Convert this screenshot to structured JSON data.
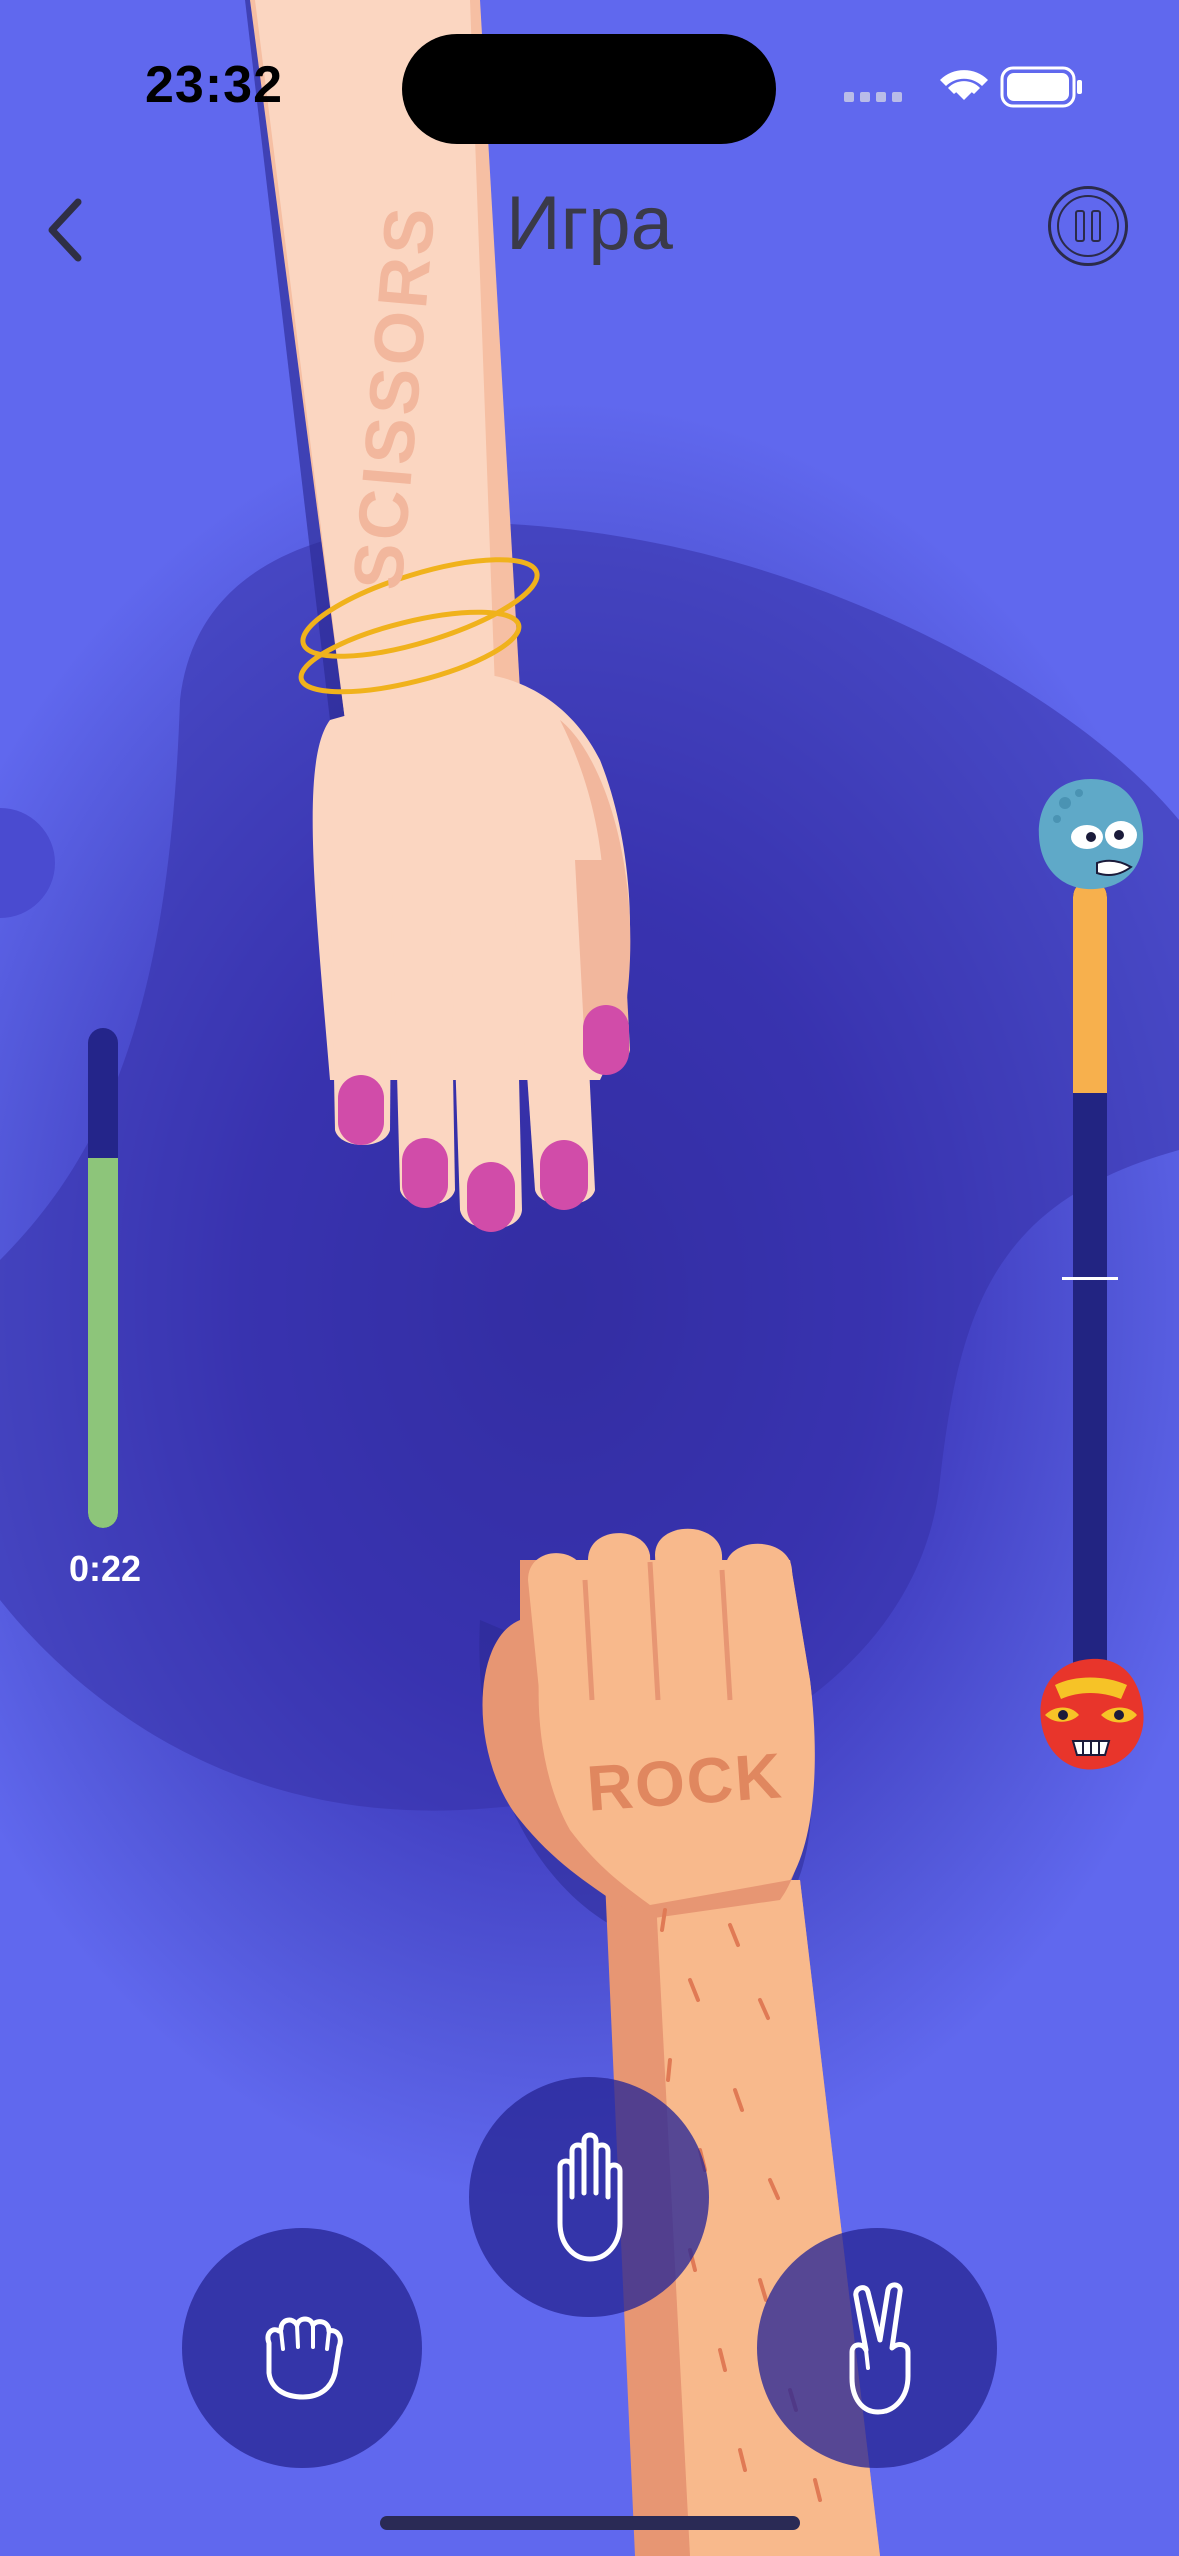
{
  "status_bar": {
    "time": "23:32"
  },
  "nav": {
    "title": "Игра"
  },
  "opponent_hand": {
    "label": "SCISSORS"
  },
  "player_hand": {
    "label": "ROCK"
  },
  "timer": {
    "text": "0:22",
    "fraction_remaining": 0.74
  },
  "score_bar": {
    "opponent_fraction": 0.26
  },
  "choices": [
    {
      "name": "rock",
      "icon": "fist-icon"
    },
    {
      "name": "paper",
      "icon": "open-hand-icon"
    },
    {
      "name": "scissors",
      "icon": "victory-hand-icon"
    }
  ],
  "colors": {
    "background": "#5a62e6",
    "timer_fill": "#8dc57a",
    "score_fill": "#f7b04d",
    "nail": "#d14ca9"
  }
}
